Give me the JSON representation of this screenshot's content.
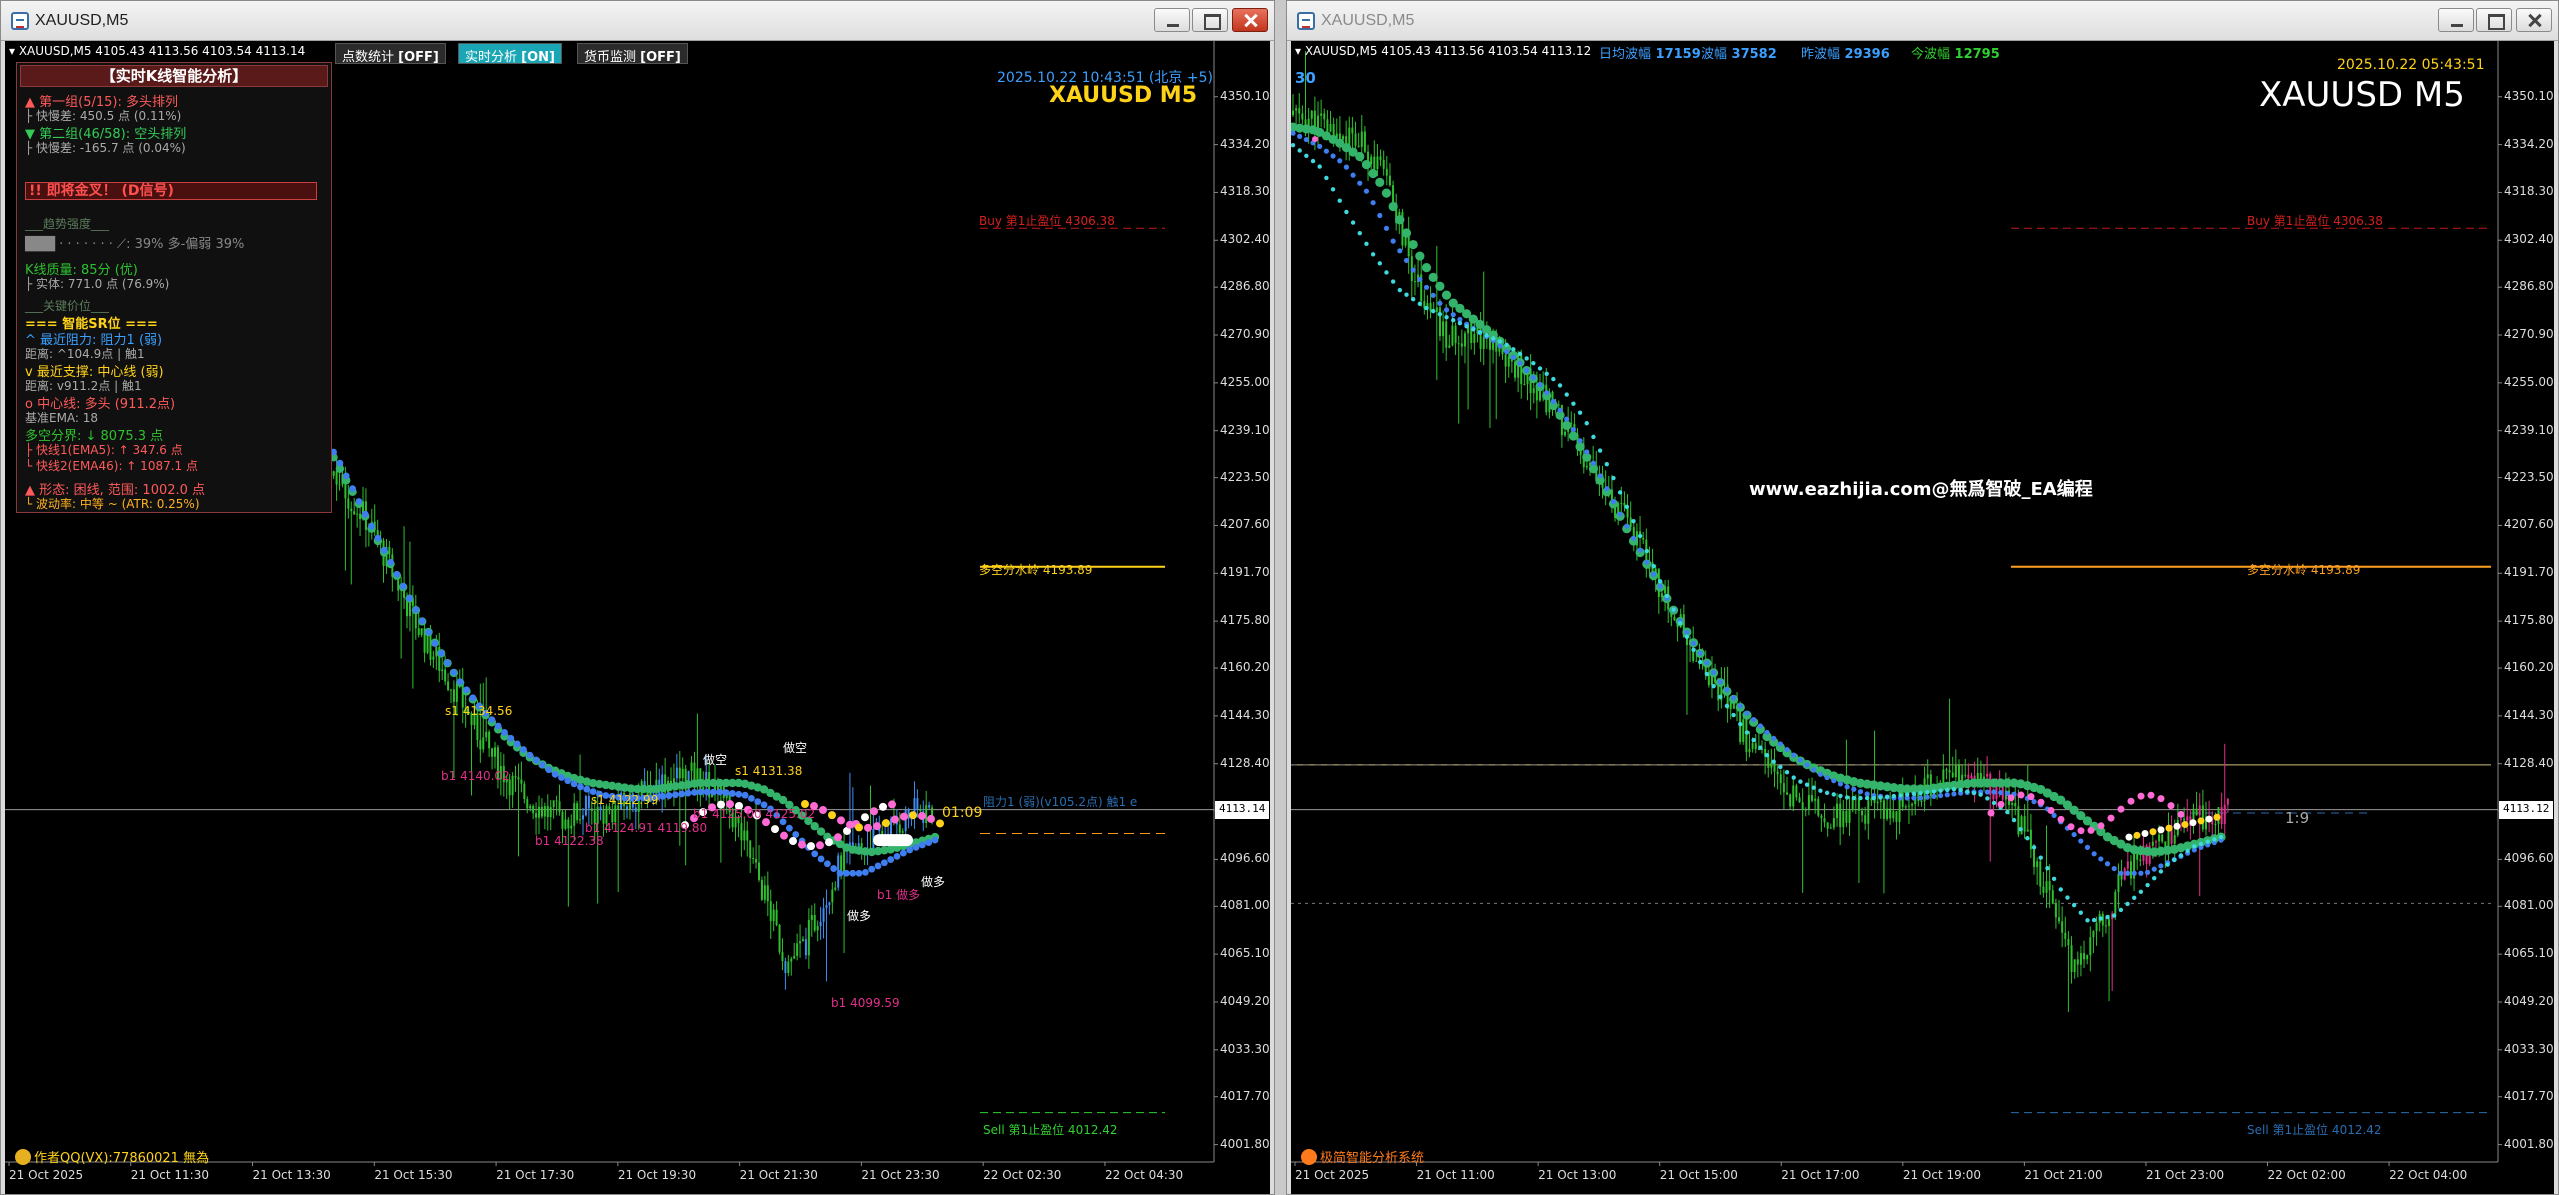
{
  "left": {
    "title": "XAUUSD,M5",
    "header": "▾ XAUUSD,M5  4105.43 4113.56 4103.54 4113.14",
    "buttons": [
      {
        "label": "点数统计",
        "state": "[OFF]"
      },
      {
        "label": "实时分析",
        "state": "[ON]"
      },
      {
        "label": "货币监测",
        "state": "[OFF]"
      }
    ],
    "datetime": "2025.10.22 10:43:51 (北京 +5)",
    "symbol": "XAUUSD M5",
    "price_tag": "4113.14",
    "countdown": "01:09",
    "price_axis": [
      "4350.10",
      "4334.20",
      "4318.30",
      "4302.40",
      "4286.80",
      "4270.90",
      "4255.00",
      "4239.10",
      "4223.50",
      "4207.60",
      "4191.70",
      "4175.80",
      "4160.20",
      "4144.30",
      "4128.40",
      "4112.80",
      "4096.60",
      "4081.00",
      "4065.10",
      "4049.20",
      "4033.30",
      "4017.70",
      "4001.80"
    ],
    "time_axis": [
      "21 Oct 2025",
      "21 Oct 11:30",
      "21 Oct 13:30",
      "21 Oct 15:30",
      "21 Oct 17:30",
      "21 Oct 19:30",
      "21 Oct 21:30",
      "21 Oct 23:30",
      "22 Oct 02:30",
      "22 Oct 04:30"
    ],
    "levels": {
      "buy_tp": "Buy 第1止盈位 4306.38",
      "mid": "多空分水岭 4193.89",
      "resist": "阻力1 (弱)(v105.2点) 触1 e",
      "sell_tp": "Sell 第1止盈位 4012.42"
    },
    "chart_labels": {
      "s1": "s1 4134.56",
      "b1a": "b1 4140.02",
      "b1b": "b1 4122.38",
      "b1c": "b1 4124.91 4119.80",
      "b1d": "b1 4125.00 4125.02",
      "s2": "s1 4131.38",
      "low": "b1 4099.59",
      "b1e": "b1 做多",
      "kong1": "做空",
      "kong2": "做空",
      "duo1": "做多",
      "duo2": "做多",
      "s1x": "s1 4122.99"
    },
    "panel": {
      "title": "【实时K线智能分析】",
      "g1": "▲ 第一组(5/15): 多头排列",
      "g1s": "├ 快慢差: 450.5 点 (0.11%)",
      "g2": "▼ 第二组(46/58): 空头排列",
      "g2s": "├ 快慢差: -165.7 点 (0.04%)",
      "alert": "!! 即将金叉！ (D信号)",
      "trend_h": "___趋势强度___",
      "trend": "███ · · · · · · ·  ⟋: 39% 多-偏弱 39%",
      "kq": "K线质量: 85分 (优)",
      "kqs": "├ 实体: 771.0 点 (76.9%)",
      "key_h": "___关键价位___",
      "sr_h": "=== 智能SR位 ===",
      "r1": "^ 最近阻力: 阻力1 (弱)",
      "r1s": "  距离: ^104.9点 | 触1",
      "sp": "v 最近支撑: 中心线 (弱)",
      "sps": "  距离: v911.2点 | 触1",
      "c": "o 中心线: 多头 (911.2点)",
      "cs": "  基准EMA: 18",
      "sep": "多空分界: ↓ 8075.3 点",
      "f1": "├ 快线1(EMA5): ↑ 347.6 点",
      "f2": "└ 快线2(EMA46): ↑ 1087.1 点",
      "shape": "▲ 形态: 困线, 范围: 1002.0 点",
      "vol": "└ 波动率: 中等 ~ (ATR: 0.25%)"
    },
    "footer": "作者QQ(VX):77860021 無為"
  },
  "right": {
    "title": "XAUUSD,M5",
    "header": "▾ XAUUSD,M5  4105.43 4113.56 4103.54 4113.12",
    "stats": [
      {
        "label": "日均波幅",
        "value": "17159"
      },
      {
        "label": "波幅",
        "value": "37582"
      },
      {
        "label": "昨波幅",
        "value": "29396"
      },
      {
        "label": "今波幅",
        "value": "12795"
      }
    ],
    "count": "30",
    "datetime": "2025.10.22 05:43:51",
    "symbol": "XAUUSD M5",
    "price_tag": "4113.12",
    "ratio": "1:9",
    "watermark": "www.eazhijia.com@無爲智破_EA编程",
    "price_axis": [
      "4350.10",
      "4334.20",
      "4318.30",
      "4302.40",
      "4286.80",
      "4270.90",
      "4255.00",
      "4239.10",
      "4223.50",
      "4207.60",
      "4191.70",
      "4175.80",
      "4160.20",
      "4144.30",
      "4128.40",
      "4112.80",
      "4096.60",
      "4081.00",
      "4065.10",
      "4049.20",
      "4033.30",
      "4017.70",
      "4001.80"
    ],
    "time_axis": [
      "21 Oct 2025",
      "21 Oct 11:00",
      "21 Oct 13:00",
      "21 Oct 15:00",
      "21 Oct 17:00",
      "21 Oct 19:00",
      "21 Oct 21:00",
      "21 Oct 23:00",
      "22 Oct 02:00",
      "22 Oct 04:00"
    ],
    "levels": {
      "buy_tp": "Buy 第1止盈位 4306.38",
      "mid": "多空分水岭 4193.89",
      "sell_tp": "Sell 第1止盈位 4012.42"
    },
    "footer": "极简智能分析系统"
  },
  "chart_data": {
    "type": "candlestick",
    "symbol": "XAUUSD",
    "timeframe": "M5",
    "ylim": [
      4000,
      4358
    ],
    "ohlc_last": {
      "open": 4105.43,
      "high": 4113.56,
      "low": 4103.54,
      "close": 4113.14
    },
    "key_levels": {
      "buy_tp": 4306.38,
      "long_short_divide": 4193.89,
      "sell_tp": 4012.42,
      "current": 4113.14
    },
    "price_path": [
      4344,
      4342,
      4339,
      4336,
      4332,
      4318,
      4295,
      4280,
      4268,
      4274,
      4268,
      4262,
      4258,
      4250,
      4240,
      4228,
      4218,
      4210,
      4198,
      4185,
      4172,
      4162,
      4152,
      4140,
      4130,
      4122,
      4116,
      4112,
      4110,
      4113,
      4112,
      4114,
      4118,
      4122,
      4124,
      4124,
      4120,
      4112,
      4098,
      4082,
      4062,
      4068,
      4082,
      4095,
      4100,
      4104,
      4108,
      4112,
      4113
    ],
    "ema_green": [
      4340,
      4339,
      4335,
      4330,
      4320,
      4305,
      4292,
      4282,
      4276,
      4270,
      4262,
      4253,
      4242,
      4230,
      4217,
      4203,
      4190,
      4177,
      4165,
      4154,
      4145,
      4137,
      4131,
      4127,
      4124,
      4122,
      4121,
      4120,
      4120,
      4121,
      4122,
      4122,
      4122,
      4120,
      4116,
      4110,
      4104,
      4100,
      4099,
      4100,
      4102,
      4104
    ],
    "ema_blue": [
      4338,
      4334,
      4328,
      4318,
      4302,
      4290,
      4280,
      4274,
      4269,
      4262,
      4253,
      4242,
      4228,
      4212,
      4197,
      4182,
      4168,
      4156,
      4146,
      4138,
      4131,
      4125,
      4121,
      4118,
      4117,
      4117,
      4118,
      4119,
      4119,
      4118,
      4114,
      4106,
      4098,
      4092,
      4092,
      4096,
      4100,
      4103
    ],
    "ema_cyan": [
      4334,
      4327,
      4312,
      4298,
      4286,
      4280,
      4276,
      4272,
      4268,
      4262,
      4255,
      4243,
      4225,
      4206,
      4186,
      4168,
      4152,
      4140,
      4130,
      4123,
      4119,
      4117,
      4117,
      4118,
      4119,
      4120,
      4118,
      4112,
      4100,
      4086,
      4076,
      4078,
      4086,
      4095,
      4101,
      4104
    ]
  }
}
